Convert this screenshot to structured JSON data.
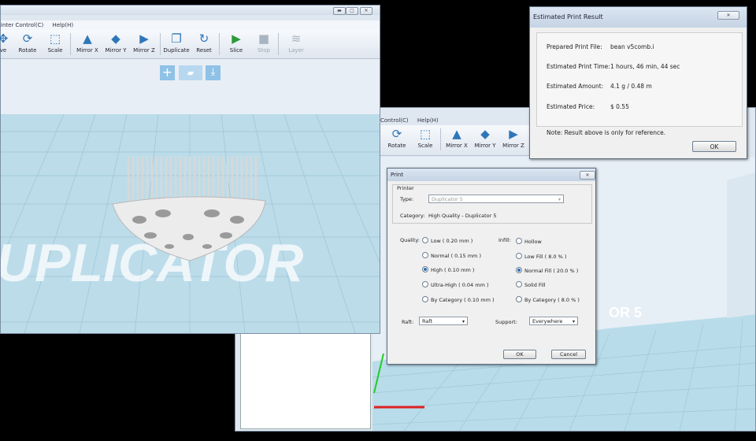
{
  "left_window": {
    "menu": [
      "inter Control(C)",
      "Help(H)"
    ],
    "toolbar": [
      {
        "label": "ve",
        "icon": "move-icon"
      },
      {
        "label": "Rotate",
        "icon": "rotate-icon"
      },
      {
        "label": "Scale",
        "icon": "scale-icon"
      },
      {
        "label": "Mirror X",
        "icon": "mirror-x-icon"
      },
      {
        "label": "Mirror Y",
        "icon": "mirror-y-icon"
      },
      {
        "label": "Mirror Z",
        "icon": "mirror-z-icon"
      },
      {
        "label": "Duplicate",
        "icon": "duplicate-icon"
      },
      {
        "label": "Reset",
        "icon": "reset-icon"
      },
      {
        "label": "Slice",
        "icon": "slice-icon"
      },
      {
        "label": "Stop",
        "icon": "stop-icon"
      },
      {
        "label": "Layer",
        "icon": "layer-icon"
      }
    ],
    "watermark": "UPLICATOR",
    "view_buttons": [
      "add-icon",
      "view-model-icon",
      "download-icon"
    ]
  },
  "right_window": {
    "menu": [
      "Control(C)",
      "Help(H)"
    ],
    "toolbar": [
      "Rotate",
      "Scale",
      "Mirror X",
      "Mirror Y",
      "Mirror Z"
    ],
    "watermark": "OR 5"
  },
  "print_dialog": {
    "title": "Print",
    "printer_group": "Printer",
    "type_label": "Type:",
    "type_value": "Duplicator 5",
    "category_label": "Category:",
    "category_value": "High Quality - Duplicator 5",
    "quality_label": "Quality:",
    "quality_options": [
      {
        "label": "Low ( 0.20 mm )",
        "selected": false
      },
      {
        "label": "Normal ( 0.15 mm )",
        "selected": false
      },
      {
        "label": "High ( 0.10 mm )",
        "selected": true
      },
      {
        "label": "Ultra-High ( 0.04 mm )",
        "selected": false
      },
      {
        "label": "By Category ( 0.10 mm )",
        "selected": false
      }
    ],
    "infill_label": "Infill:",
    "infill_options": [
      {
        "label": "Hollow",
        "selected": false
      },
      {
        "label": "Low Fill ( 8.0 % )",
        "selected": false
      },
      {
        "label": "Normal Fill ( 20.0 % )",
        "selected": true
      },
      {
        "label": "Solid Fill",
        "selected": false
      },
      {
        "label": "By Category ( 8.0 % )",
        "selected": false
      }
    ],
    "raft_label": "Raft:",
    "raft_value": "Raft",
    "support_label": "Support:",
    "support_value": "Everywhere",
    "ok": "OK",
    "cancel": "Cancel"
  },
  "result_dialog": {
    "title": "Estimated Print Result",
    "rows": [
      {
        "label": "Prepared Print File:",
        "value": "bean v5comb.i"
      },
      {
        "label": "Estimated Print Time:",
        "value": "1 hours, 46 min, 44 sec"
      },
      {
        "label": "Estimated Amount:",
        "value": "4.1 g / 0.48 m"
      },
      {
        "label": "Estimated Price:",
        "value": "$ 0.55"
      }
    ],
    "note": "Note: Result above is only for reference.",
    "ok": "OK"
  },
  "colors": {
    "floor": "#b9dcea",
    "accent": "#2f76b8",
    "axis_green": "#22cc22",
    "axis_red": "#dd2222"
  }
}
